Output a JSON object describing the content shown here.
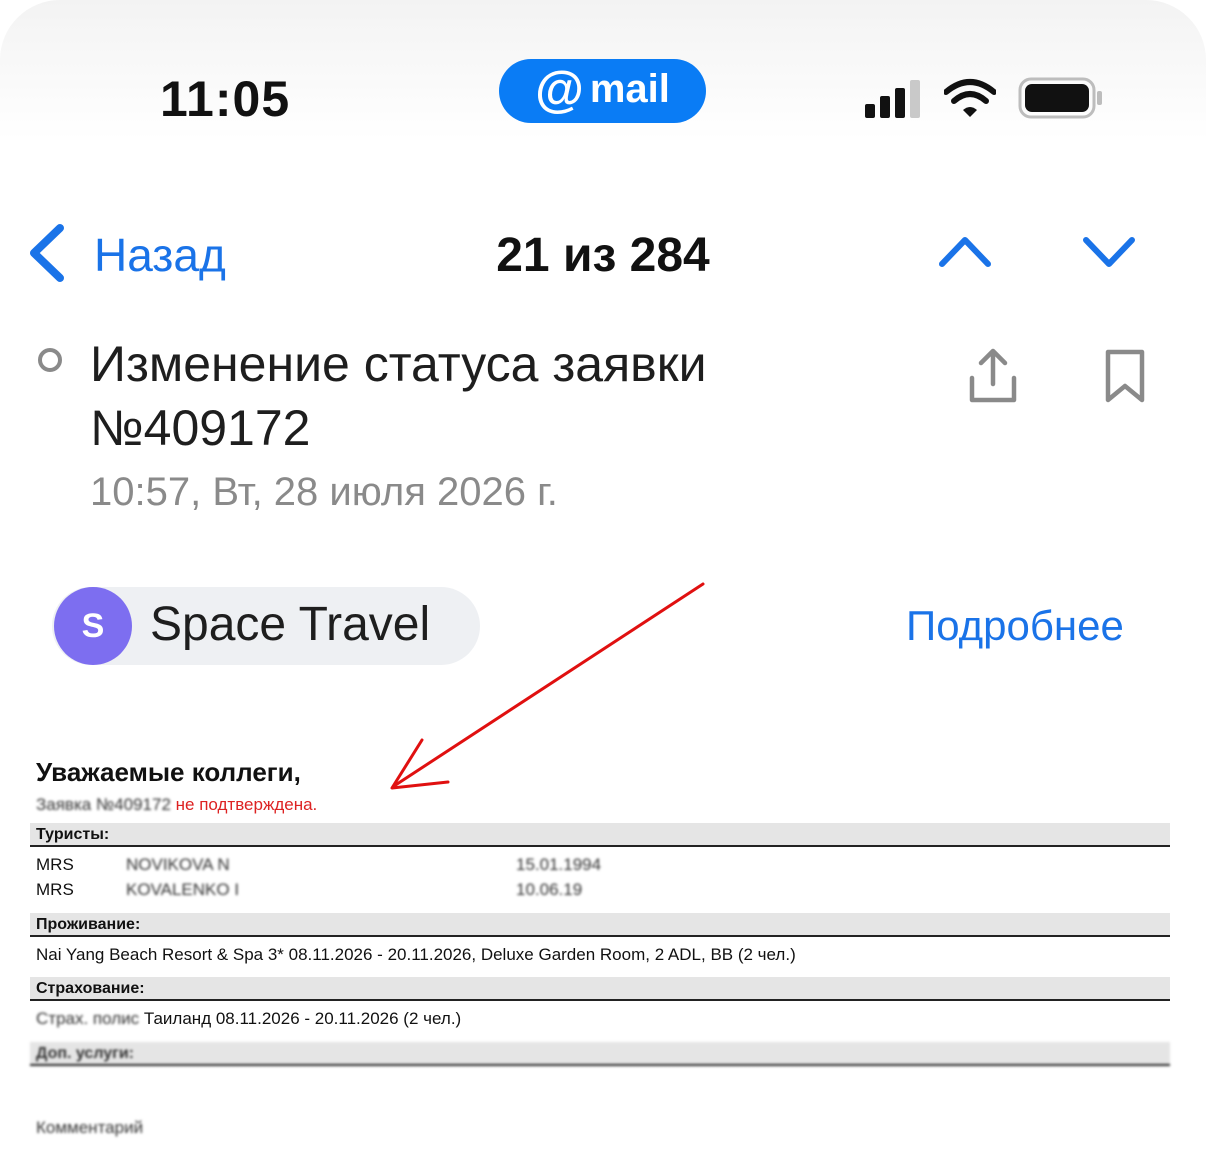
{
  "status_bar": {
    "time": "11:05",
    "app_badge": {
      "at": "@",
      "word": "mail",
      "color": "#0a7cf5"
    }
  },
  "nav": {
    "back_label": "Назад",
    "counter": "21 из 284"
  },
  "message": {
    "subject": "Изменение статуса заявки №409172",
    "date": "10:57, Вт, 28 июля 2026 г."
  },
  "sender": {
    "avatar_letter": "S",
    "name": "Space Travel",
    "details_label": "Подробнее",
    "avatar_color": "#7d6ef0"
  },
  "document": {
    "greeting": "Уважаемые коллеги,",
    "status_prefix": "Заявка №409172",
    "status_text": "не подтверждена.",
    "sections": {
      "tourists": "Туристы:",
      "accommodation": "Проживание:",
      "insurance": "Страхование:",
      "extra": "Доп. услуги:",
      "comments": "Комментарий"
    },
    "tourists": [
      {
        "title": "MRS",
        "name": "NOVIKOVA N",
        "dob": "15.01.1994"
      },
      {
        "title": "MRS",
        "name": "KOVALENKO I",
        "dob": "10.06.19"
      }
    ],
    "accommodation_line": "Nai Yang Beach Resort & Spa 3* 08.11.2026 - 20.11.2026, Deluxe Garden Room, 2 ADL, BB (2 чел.)",
    "insurance_prefix": "Страх. полис",
    "insurance_line": "Таиланд 08.11.2026 - 20.11.2026 (2 чел.)"
  },
  "icons": {
    "back": "chevron-left-icon",
    "up": "chevron-up-icon",
    "down": "chevron-down-icon",
    "share": "share-icon",
    "bookmark": "bookmark-icon",
    "unread": "unread-dot-icon"
  },
  "colors": {
    "accent": "#1a73e8",
    "annotation": "#e01010"
  }
}
